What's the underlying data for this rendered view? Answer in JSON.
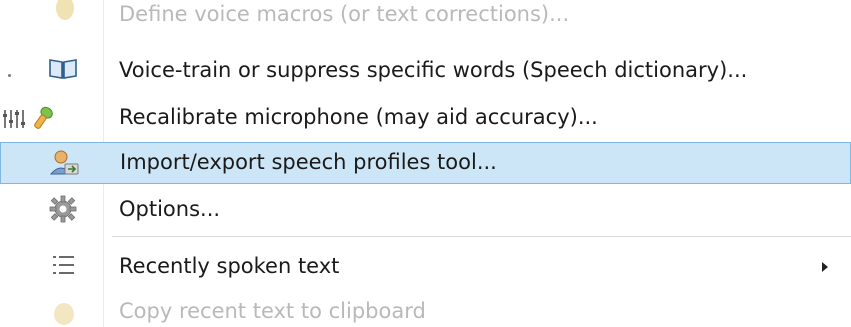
{
  "menu": {
    "items": [
      {
        "label": "Define voice macros (or text corrections)...",
        "icon": "macro-icon",
        "state": "disabled"
      },
      {
        "label": "Voice-train or suppress specific words (Speech dictionary)...",
        "icon": "book-icon",
        "state": "enabled"
      },
      {
        "label": "Recalibrate microphone (may aid accuracy)...",
        "icon": "microphone-calibrate-icon",
        "state": "enabled"
      },
      {
        "label": "Import/export speech profiles tool...",
        "icon": "user-profile-icon",
        "state": "highlighted"
      },
      {
        "label": "Options...",
        "icon": "gear-icon",
        "state": "enabled"
      },
      {
        "label": "Recently spoken text",
        "icon": "list-icon",
        "state": "enabled",
        "has_submenu": true
      },
      {
        "label": "Copy recent text to clipboard",
        "icon": "clipboard-icon",
        "state": "disabled"
      }
    ]
  },
  "colors": {
    "highlight_bg": "#cde6f7",
    "highlight_border": "#7fb8e3",
    "disabled_text": "#b9b9b9",
    "text": "#1a1a1a"
  }
}
